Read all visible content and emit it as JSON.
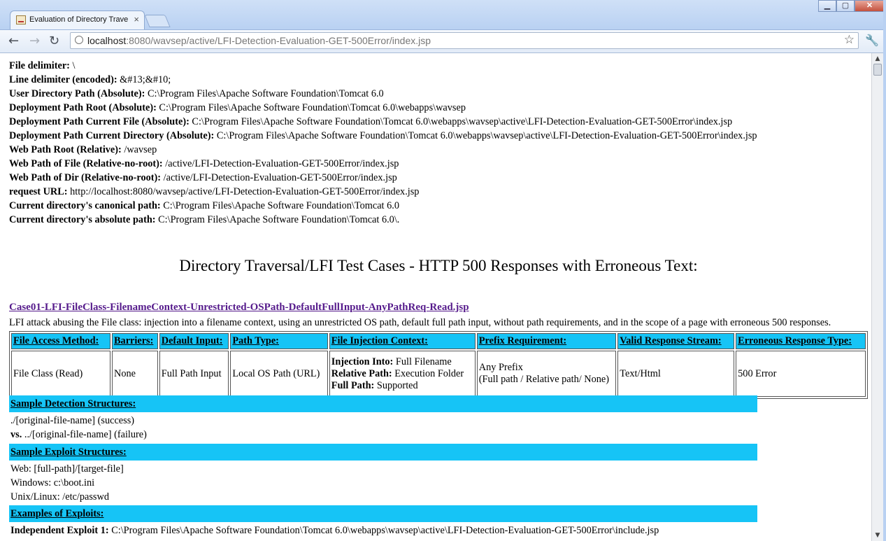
{
  "tab": {
    "title": "Evaluation of Directory Trave",
    "close": "×"
  },
  "window": {
    "minimize": "▁",
    "maximize": "▢",
    "close": "✕"
  },
  "nav": {
    "back": "←",
    "forward": "→",
    "reload": "↻",
    "star": "☆",
    "wrench": "🔧"
  },
  "address": {
    "host": "localhost",
    "rest": ":8080/wavsep/active/LFI-Detection-Evaluation-GET-500Error/index.jsp"
  },
  "info": [
    {
      "label": "File delimiter:",
      "value": " \\"
    },
    {
      "label": "Line delimiter (encoded):",
      "value": " &#13;&#10;"
    },
    {
      "label": "User Directory Path (Absolute):",
      "value": " C:\\Program Files\\Apache Software Foundation\\Tomcat 6.0"
    },
    {
      "label": "Deployment Path Root (Absolute):",
      "value": " C:\\Program Files\\Apache Software Foundation\\Tomcat 6.0\\webapps\\wavsep"
    },
    {
      "label": "Deployment Path Current File (Absolute):",
      "value": " C:\\Program Files\\Apache Software Foundation\\Tomcat 6.0\\webapps\\wavsep\\active\\LFI-Detection-Evaluation-GET-500Error\\index.jsp"
    },
    {
      "label": "Deployment Path Current Directory (Absolute):",
      "value": " C:\\Program Files\\Apache Software Foundation\\Tomcat 6.0\\webapps\\wavsep\\active\\LFI-Detection-Evaluation-GET-500Error\\index.jsp"
    },
    {
      "label": "Web Path Root (Relative):",
      "value": " /wavsep"
    },
    {
      "label": "Web Path of File (Relative-no-root):",
      "value": " /active/LFI-Detection-Evaluation-GET-500Error/index.jsp"
    },
    {
      "label": "Web Path of Dir (Relative-no-root):",
      "value": " /active/LFI-Detection-Evaluation-GET-500Error/index.jsp"
    },
    {
      "label": "request URL:",
      "value": " http://localhost:8080/wavsep/active/LFI-Detection-Evaluation-GET-500Error/index.jsp"
    },
    {
      "label": "Current directory's canonical path:",
      "value": " C:\\Program Files\\Apache Software Foundation\\Tomcat 6.0"
    },
    {
      "label": "Current directory's absolute path:",
      "value": " C:\\Program Files\\Apache Software Foundation\\Tomcat 6.0\\."
    }
  ],
  "heading": "Directory Traversal/LFI Test Cases - HTTP 500 Responses with Erroneous Text:",
  "case": {
    "link": "Case01-LFI-FileClass-FilenameContext-Unrestricted-OSPath-DefaultFullInput-AnyPathReq-Read.jsp",
    "description": "LFI attack abusing the File class: injection into a filename context, using an unrestricted OS path, default full path input, without path requirements, and in the scope of a page with erroneous 500 responses.",
    "headers": [
      "File Access Method:",
      "Barriers:",
      "Default Input:",
      "Path Type:",
      "File Injection Context:",
      "Prefix Requirement:",
      "Valid Response Stream:",
      "Erroneous Response Type:"
    ],
    "row": {
      "method": "File Class (Read)",
      "barriers": "None",
      "input": "Full Path Input",
      "path_type": "Local OS Path (URL)",
      "ctx_l1": "Injection Into:",
      "ctx_v1": " Full Filename",
      "ctx_l2": "Relative Path:",
      "ctx_v2": " Execution Folder",
      "ctx_l3": "Full Path:",
      "ctx_v3": " Supported",
      "prefix_1": "Any Prefix",
      "prefix_2": "(Full path / Relative path/ None)",
      "stream": "Text/Html",
      "error": "500 Error"
    }
  },
  "detection": {
    "title": "Sample Detection Structures:",
    "line1": "./[original-file-name] (success)",
    "vs": "vs.",
    "line2": " ../[original-file-name] (failure)"
  },
  "exploit": {
    "title": "Sample Exploit Structures:",
    "lines": [
      "Web: [full-path]/[target-file]",
      "Windows: c:\\boot.ini",
      "Unix/Linux: /etc/passwd"
    ]
  },
  "examples": {
    "title": "Examples of Exploits:",
    "label": "Independent Exploit 1:",
    "value": " C:\\Program Files\\Apache Software Foundation\\Tomcat 6.0\\webapps\\wavsep\\active\\LFI-Detection-Evaluation-GET-500Error\\include.jsp"
  },
  "scrollbar": {
    "up": "▲",
    "down": "▼"
  }
}
